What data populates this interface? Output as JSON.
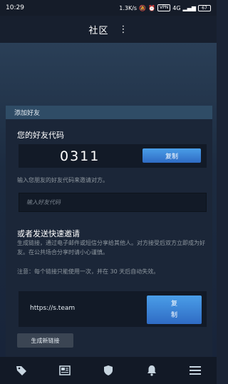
{
  "status_bar": {
    "time": "10:29",
    "speed": "1.3K/s",
    "vpn": "VPN",
    "network": "4G",
    "battery": "67"
  },
  "header": {
    "title": "社区",
    "menu_icon": "⋮"
  },
  "add_friend": {
    "panel_title": "添加好友",
    "code_section_title": "您的好友代码",
    "friend_code": "0311",
    "copy_label": "复制",
    "code_hint": "输入您朋友的好友代码来邀请对方。",
    "input_placeholder": "输入好友代码"
  },
  "quick_invite": {
    "title": "或者发送快速邀请",
    "description": "生成链接，通过电子邮件或短信分享给其他人。对方接受后双方立即成为好友。在公共场合分享时请小心谨慎。",
    "note": "注意：每个链接只能使用一次，并在 30 天后自动失效。",
    "link": "https://s.team",
    "copy_label_line1": "复",
    "copy_label_line2": "制",
    "new_link_label": "生成新链接"
  },
  "bottom_nav": {
    "items": [
      "tag-icon",
      "news-icon",
      "shield-icon",
      "bell-icon",
      "menu-icon"
    ]
  },
  "colors": {
    "accent": "#3d83d6",
    "panel_header": "#2f4c66",
    "background": "#1a2335"
  }
}
